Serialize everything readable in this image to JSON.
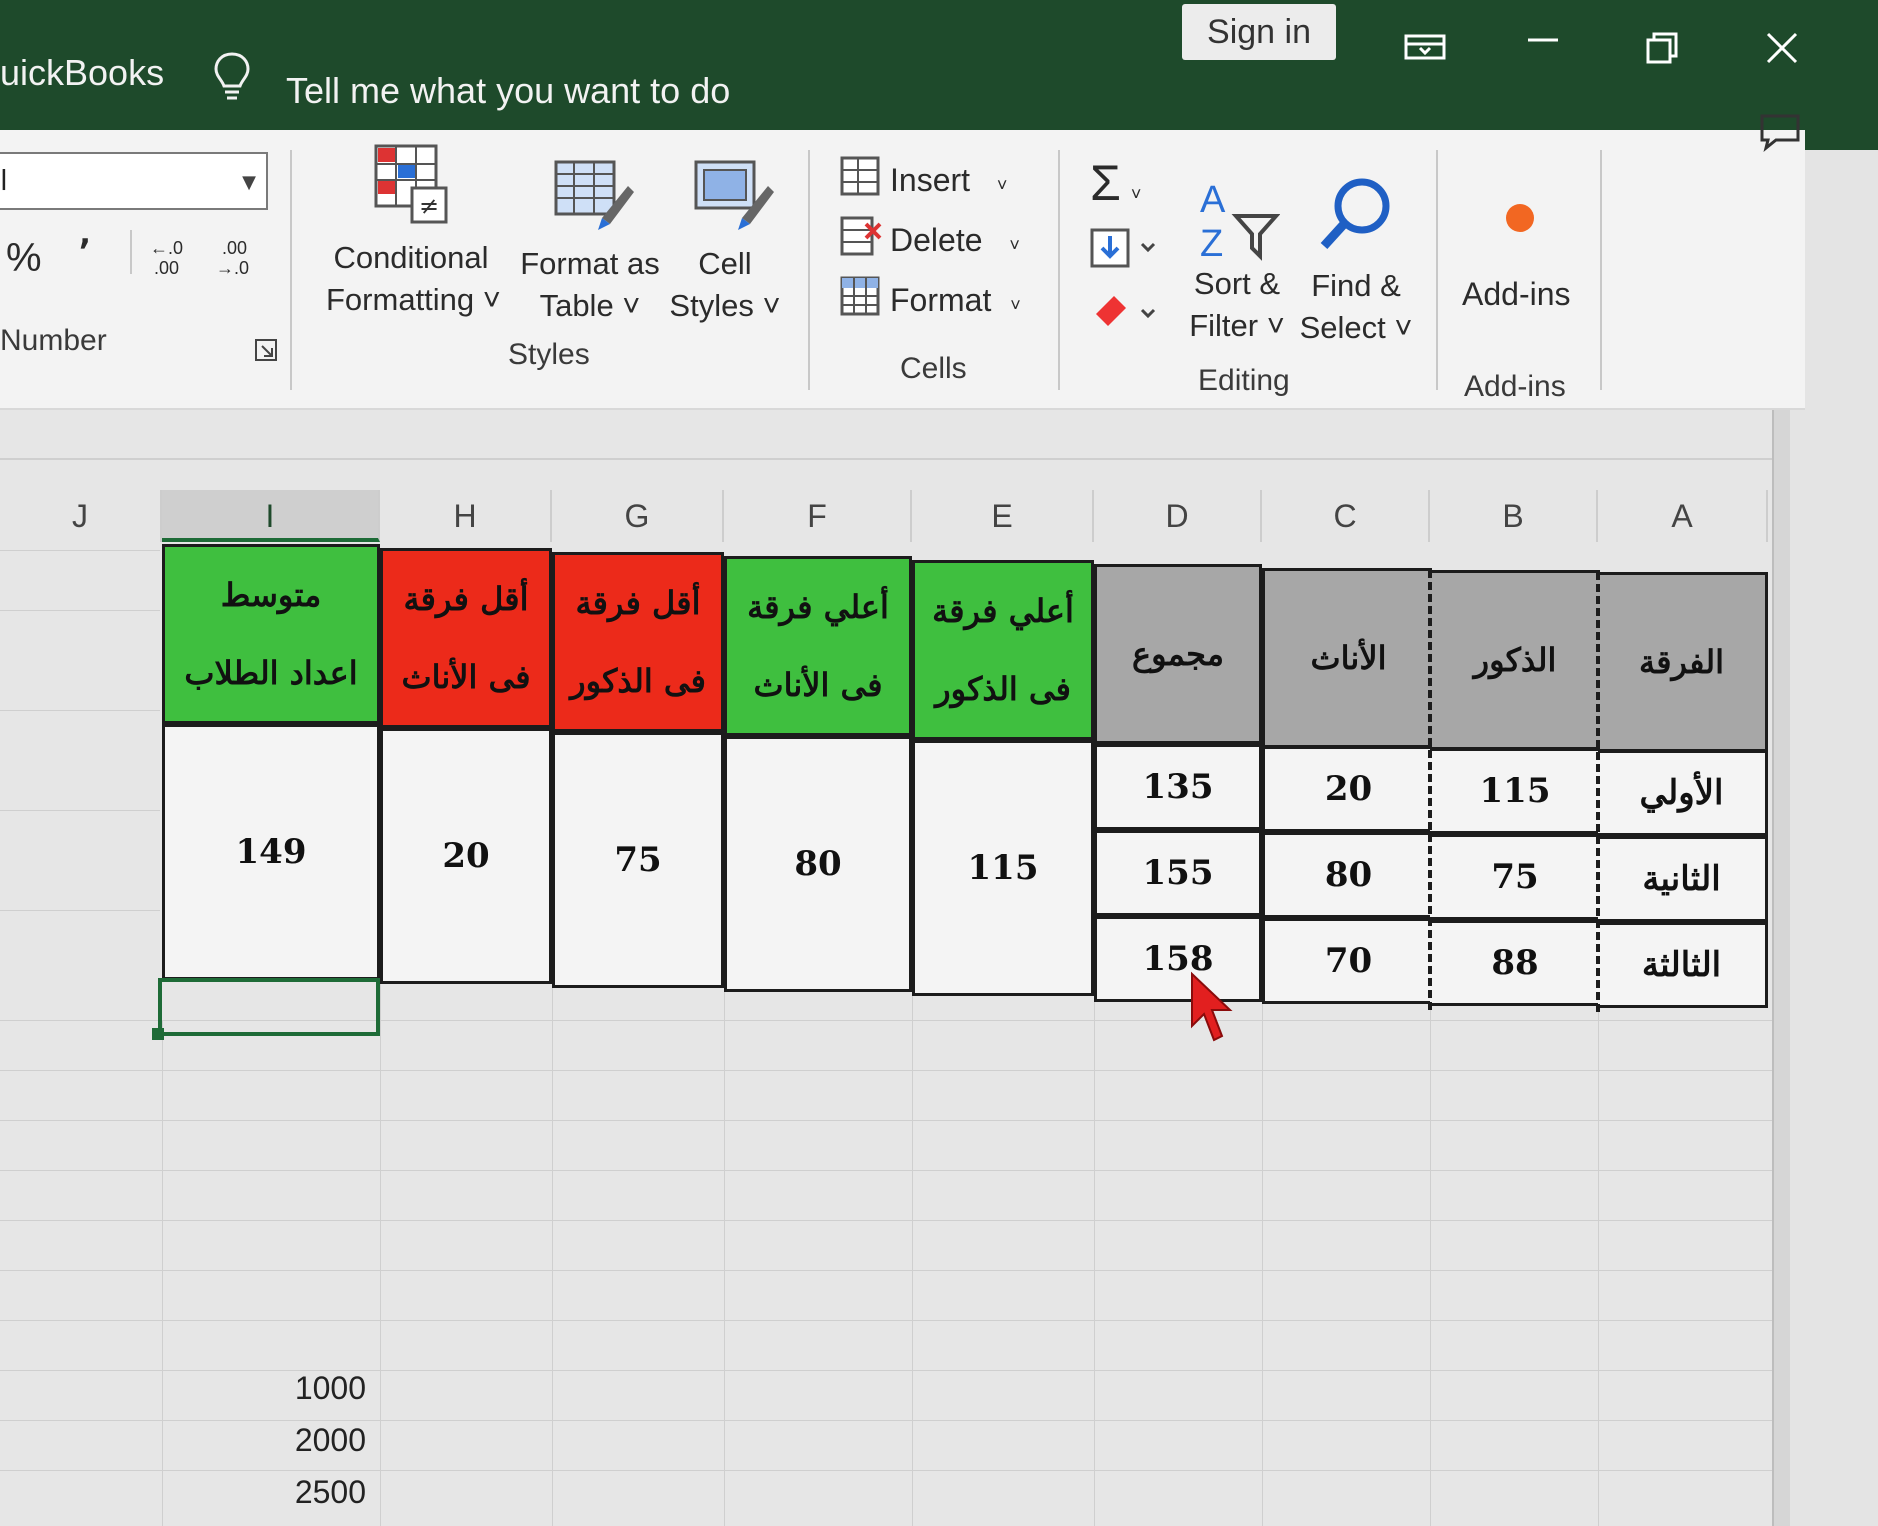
{
  "titlebar": {
    "app_name": "uickBooks",
    "tell_me": "Tell me what you want to do",
    "sign_in": "Sign in"
  },
  "ribbon": {
    "number_format_value": "l",
    "number": {
      "percent": "%",
      "comma": "٬",
      "increase_decimal": "←.0\n.00",
      "decrease_decimal": ".00\n→.0",
      "group_label": "Number"
    },
    "styles": {
      "conditional_formatting": [
        "Conditional",
        "Formatting ˅"
      ],
      "format_as_table": [
        "Format as",
        "Table ˅"
      ],
      "cell_styles": [
        "Cell",
        "Styles ˅"
      ],
      "group_label": "Styles"
    },
    "cells": {
      "insert": "Insert",
      "delete": "Delete",
      "format": "Format",
      "group_label": "Cells"
    },
    "editing": {
      "sort_filter": [
        "Sort &",
        "Filter ˅"
      ],
      "find_select": [
        "Find &",
        "Select ˅"
      ],
      "group_label": "Editing"
    },
    "addins": {
      "addins": "Add-ins",
      "group_label": "Add-ins"
    }
  },
  "sheet": {
    "columns": [
      "J",
      "I",
      "H",
      "G",
      "F",
      "E",
      "D",
      "C",
      "B",
      "A"
    ],
    "selected_column": "I",
    "headers": {
      "A": "الفرقة",
      "B": "الذكور",
      "C": "الأناث",
      "D": "مجموع",
      "E": [
        "أعلي فرقة",
        "فى الذكور"
      ],
      "F": [
        "أعلي فرقة",
        "فى الأناث"
      ],
      "G": [
        "أقل فرقة",
        "فى الذكور"
      ],
      "H": [
        "أقل فرقة",
        "فى الأناث"
      ],
      "I": [
        "متوسط",
        "اعداد الطلاب"
      ]
    },
    "rows": [
      {
        "A": "الأولي",
        "B": "115",
        "C": "20",
        "D": "135"
      },
      {
        "A": "الثانية",
        "B": "75",
        "C": "80",
        "D": "155"
      },
      {
        "A": "الثالثة",
        "B": "88",
        "C": "70",
        "D": "158"
      }
    ],
    "summary": {
      "E": "115",
      "F": "80",
      "G": "75",
      "H": "20",
      "I": "149"
    },
    "extra_values": [
      "1000",
      "2000",
      "2500"
    ]
  },
  "colors": {
    "titlebar": "#1e4a2b",
    "header_green": "#3fbf3f",
    "header_red": "#ec2a1a",
    "header_gray": "#a7a7a7",
    "selection": "#1e6b37"
  }
}
